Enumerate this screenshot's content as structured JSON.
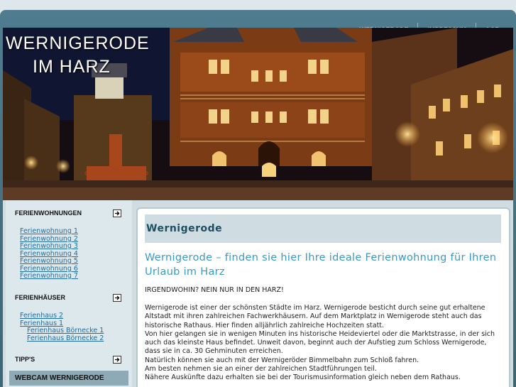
{
  "nav": {
    "items": [
      "WERNIGERODE",
      "IMPRESSUM",
      "AGB"
    ]
  },
  "hero": {
    "title_line1": "WERNIGERODE",
    "title_line2": "IM HARZ"
  },
  "sidebar": {
    "sections": [
      {
        "heading": "FERIENWOHNUNGEN",
        "links": [
          "Ferienwohnung 1",
          "Ferienwohnung 2",
          "Ferienwohnung 3",
          "Ferienwohnung 4",
          "Ferienwohnung 5",
          "Ferienwohnung 6",
          "Ferienwohnung 7"
        ]
      },
      {
        "heading": "FERIENHÄUSER",
        "links": [
          "Ferienhaus 2",
          "Ferienhaus 1"
        ],
        "sublinks": [
          "Ferienhaus Börnecke 1",
          "Ferienhaus Börnecke 2"
        ]
      },
      {
        "heading": "TIPP'S"
      }
    ],
    "webcam_label": "WEBCAM WERNIGERODE"
  },
  "content": {
    "title": "Wernigerode",
    "heading": "Wernigerode – finden sie hier Ihre ideale Ferienwohnung für Ihren Urlaub im Harz",
    "subheading": "IRGENDWOHIN?  NEIN NUR IN DEN HARZ!",
    "paragraphs": [
      "Wernigerode ist einer der schönsten Städte im Harz. Wernigerode besticht durch seine gut erhaltene Altstadt mit ihren zahlreichen Fachwerkhäusern. Auf dem Marktplatz in Wernigerode steht auch das historische Rathaus. Hier finden alljährlich zahlreiche Hochzeiten statt.",
      "Von hier gelangen sie in wenigen Minuten ins historische Heideviertel oder die Marktstrasse, in der sich auch das kleinste Haus befindet. Unweit davon, beginnt auch der Aufstieg zum Schloss Wernigerode, dass sie in ca. 30 Gehminuten erreichen.",
      "Natürlich können sie auch mit der Wernigeröder Bimmelbahn zum Schloß fahren.",
      "Am besten nehmen sie an einer der zahlreichen Stadtführungen teil.",
      "Nähere Auskünfte dazu erhalten sie bei der Tourismusinformation gleich neben dem Rathaus."
    ]
  }
}
